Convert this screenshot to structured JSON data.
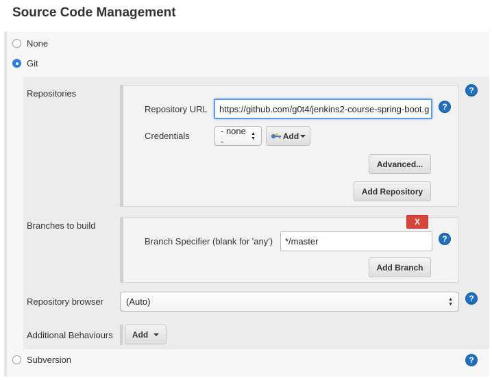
{
  "section": {
    "title": "Source Code Management"
  },
  "scm_options": {
    "none": "None",
    "git": "Git",
    "subversion": "Subversion",
    "selected": "Git"
  },
  "repositories": {
    "label": "Repositories",
    "repo_url_label": "Repository URL",
    "repo_url_value": "https://github.com/g0t4/jenkins2-course-spring-boot.g",
    "credentials_label": "Credentials",
    "credentials_value": "- none -",
    "credentials_add": "Add",
    "advanced_button": "Advanced...",
    "add_repository_button": "Add Repository"
  },
  "branches": {
    "label": "Branches to build",
    "delete_button": "X",
    "specifier_label": "Branch Specifier (blank for 'any')",
    "specifier_value": "*/master",
    "add_branch_button": "Add Branch"
  },
  "browser": {
    "label": "Repository browser",
    "value": "(Auto)"
  },
  "behaviours": {
    "label": "Additional Behaviours",
    "add_button": "Add"
  },
  "help_glyph": "?",
  "icons": {
    "help": "help-icon",
    "key": "key-icon",
    "select_arrows": "select-arrows-icon",
    "caret": "chevron-down-icon"
  },
  "colors": {
    "accent": "#2f7fd8",
    "help": "#1f6fbf",
    "danger": "#d9443a",
    "panel": "#ececec"
  }
}
